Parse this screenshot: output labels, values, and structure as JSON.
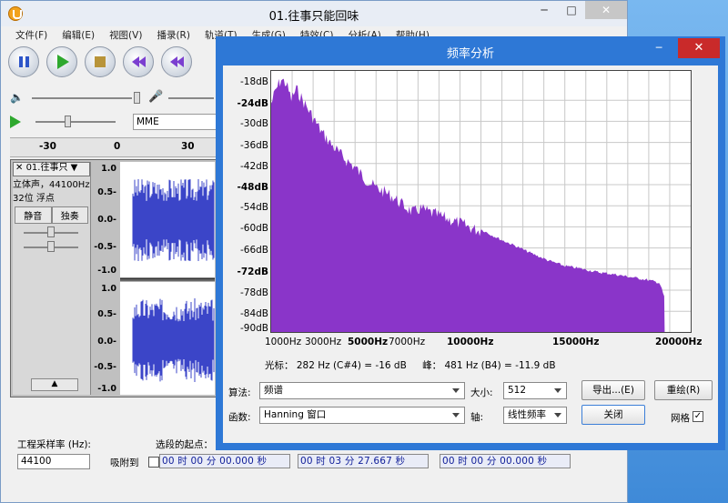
{
  "main_window": {
    "title": "01.往事只能回味",
    "minimize": "─",
    "maximize": "□",
    "close": "✕"
  },
  "menu": [
    "文件(F)",
    "编辑(E)",
    "视图(V)",
    "播录(R)",
    "轨道(T)",
    "生成(G)",
    "特效(C)",
    "分析(A)",
    "帮助(H)"
  ],
  "device_select": "MME",
  "ruler": {
    "ticks": [
      "-30",
      "0",
      "30"
    ]
  },
  "track": {
    "name": "01.往事只",
    "info_line1": "立体声，44100Hz",
    "info_line2": "32位 浮点",
    "mute": "静音",
    "solo": "独奏",
    "scale": [
      "1.0",
      "0.5-",
      "0.0-",
      "-0.5-",
      "-1.0",
      "1.0",
      "0.5-",
      "0.0-",
      "-0.5-",
      "-1.0"
    ]
  },
  "bottom": {
    "rate_label": "工程采样率 (Hz):",
    "rate_value": "44100",
    "snap_label": "吸附到",
    "sel_start_label": "选段的起点：",
    "time1": "00 时 00 分 00.000 秒",
    "time2": "00 时 03 分 27.667 秒",
    "time3": "00 时 00 分 00.000 秒"
  },
  "dialog": {
    "title": "频率分析",
    "close": "✕",
    "minimize": "─",
    "y_ticks": [
      {
        "t": "-18dB",
        "b": false
      },
      {
        "t": "-24dB",
        "b": true
      },
      {
        "t": "-30dB",
        "b": false
      },
      {
        "t": "-36dB",
        "b": false
      },
      {
        "t": "-42dB",
        "b": false
      },
      {
        "t": "-48dB",
        "b": true
      },
      {
        "t": "-54dB",
        "b": false
      },
      {
        "t": "-60dB",
        "b": false
      },
      {
        "t": "-66dB",
        "b": false
      },
      {
        "t": "-72dB",
        "b": true
      },
      {
        "t": "-78dB",
        "b": false
      },
      {
        "t": "-84dB",
        "b": false
      },
      {
        "t": "-90dB",
        "b": false
      }
    ],
    "x_ticks": [
      {
        "t": "1000Hz",
        "b": false
      },
      {
        "t": "3000Hz",
        "b": false
      },
      {
        "t": "5000Hz",
        "b": true
      },
      {
        "t": "7000Hz",
        "b": false
      },
      {
        "t": "10000Hz",
        "b": true
      },
      {
        "t": "15000Hz",
        "b": true
      },
      {
        "t": "20000Hz",
        "b": true
      }
    ],
    "cursor_text": "光标： 282 Hz (C#4) = -16 dB",
    "peak_text": "峰： 481 Hz (B4) = -11.9 dB",
    "algo_label": "算法:",
    "algo_value": "频谱",
    "size_label": "大小:",
    "size_value": "512",
    "export_button": "导出...(E)",
    "replot_button": "重绘(R)",
    "func_label": "函数:",
    "func_value": "Hanning 窗口",
    "axis_label": "轴:",
    "axis_value": "线性频率",
    "close_button": "关闭",
    "grid_label": "网格",
    "grid_checked": "✓",
    "fill_color": "#8a35c9"
  }
}
